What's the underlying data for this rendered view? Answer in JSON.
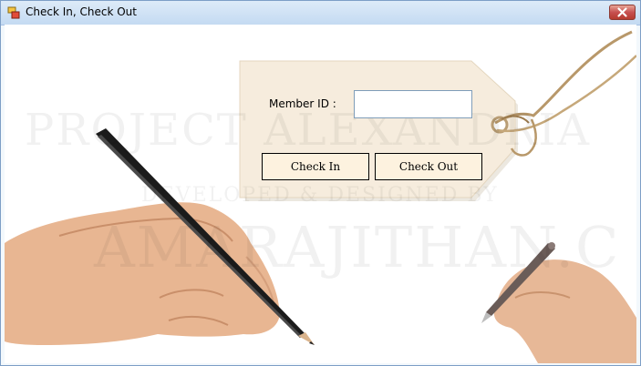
{
  "window": {
    "title": "Check In, Check Out",
    "icons": {
      "app": "app-window-icon",
      "close": "close-icon"
    }
  },
  "form": {
    "member_id_label": "Member ID  :",
    "member_id_value": "",
    "check_in_label": "Check In",
    "check_out_label": "Check Out"
  },
  "watermark": {
    "line1": "PROJECT ALEXANDRIA",
    "line2": "DEVELOPED & DESIGNED BY",
    "line3": "AMARAJITHAN.C"
  },
  "colors": {
    "tag": "#f6ecdd",
    "button_bg": "#fdf2df",
    "titlebar": "#cfe0f4",
    "close": "#c75050"
  }
}
